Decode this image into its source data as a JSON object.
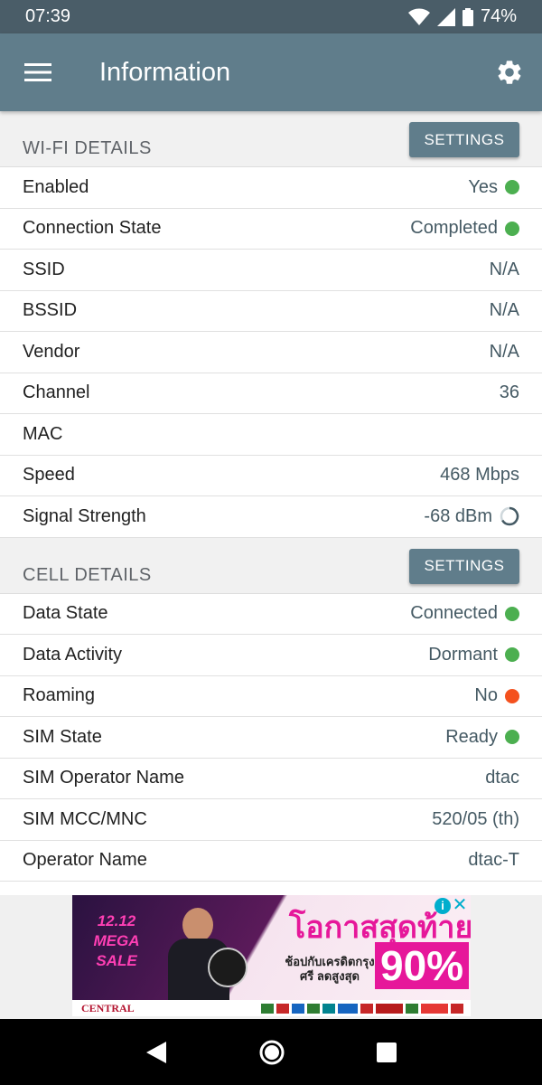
{
  "status_bar": {
    "time": "07:39",
    "battery": "74%"
  },
  "app_bar": {
    "title": "Information"
  },
  "wifi": {
    "header": "WI-FI DETAILS",
    "settings_label": "SETTINGS",
    "rows": [
      {
        "key": "Enabled",
        "value": "Yes"
      },
      {
        "key": "Connection State",
        "value": "Completed"
      },
      {
        "key": "SSID",
        "value": "N/A"
      },
      {
        "key": "BSSID",
        "value": "N/A"
      },
      {
        "key": "Vendor",
        "value": "N/A"
      },
      {
        "key": "Channel",
        "value": "36"
      },
      {
        "key": "MAC",
        "value": ""
      },
      {
        "key": "Speed",
        "value": "468 Mbps"
      },
      {
        "key": "Signal Strength",
        "value": "-68 dBm"
      }
    ]
  },
  "cell": {
    "header": "CELL DETAILS",
    "settings_label": "SETTINGS",
    "rows": [
      {
        "key": "Data State",
        "value": "Connected"
      },
      {
        "key": "Data Activity",
        "value": "Dormant"
      },
      {
        "key": "Roaming",
        "value": "No"
      },
      {
        "key": "SIM State",
        "value": "Ready"
      },
      {
        "key": "SIM Operator Name",
        "value": "dtac"
      },
      {
        "key": "SIM MCC/MNC",
        "value": "520/05 (th)"
      },
      {
        "key": "Operator Name",
        "value": "dtac-T"
      }
    ]
  },
  "ad": {
    "sale_text": "12.12 MEGA SALE",
    "headline": "โอกาสสุดท้าย",
    "subline": "ช้อปกับเครดิตกรุงศรี ลดสูงสุด",
    "percent": "90%",
    "brand": "CENTRAL"
  },
  "colors": {
    "green": "#4caf50",
    "orange": "#f4511e",
    "primary": "#607d8b",
    "status": "#4a5d68"
  },
  "icons": [
    "wifi-icon",
    "signal-icon",
    "battery-icon",
    "menu-icon",
    "gear-icon",
    "back-icon",
    "home-icon",
    "recents-icon"
  ]
}
